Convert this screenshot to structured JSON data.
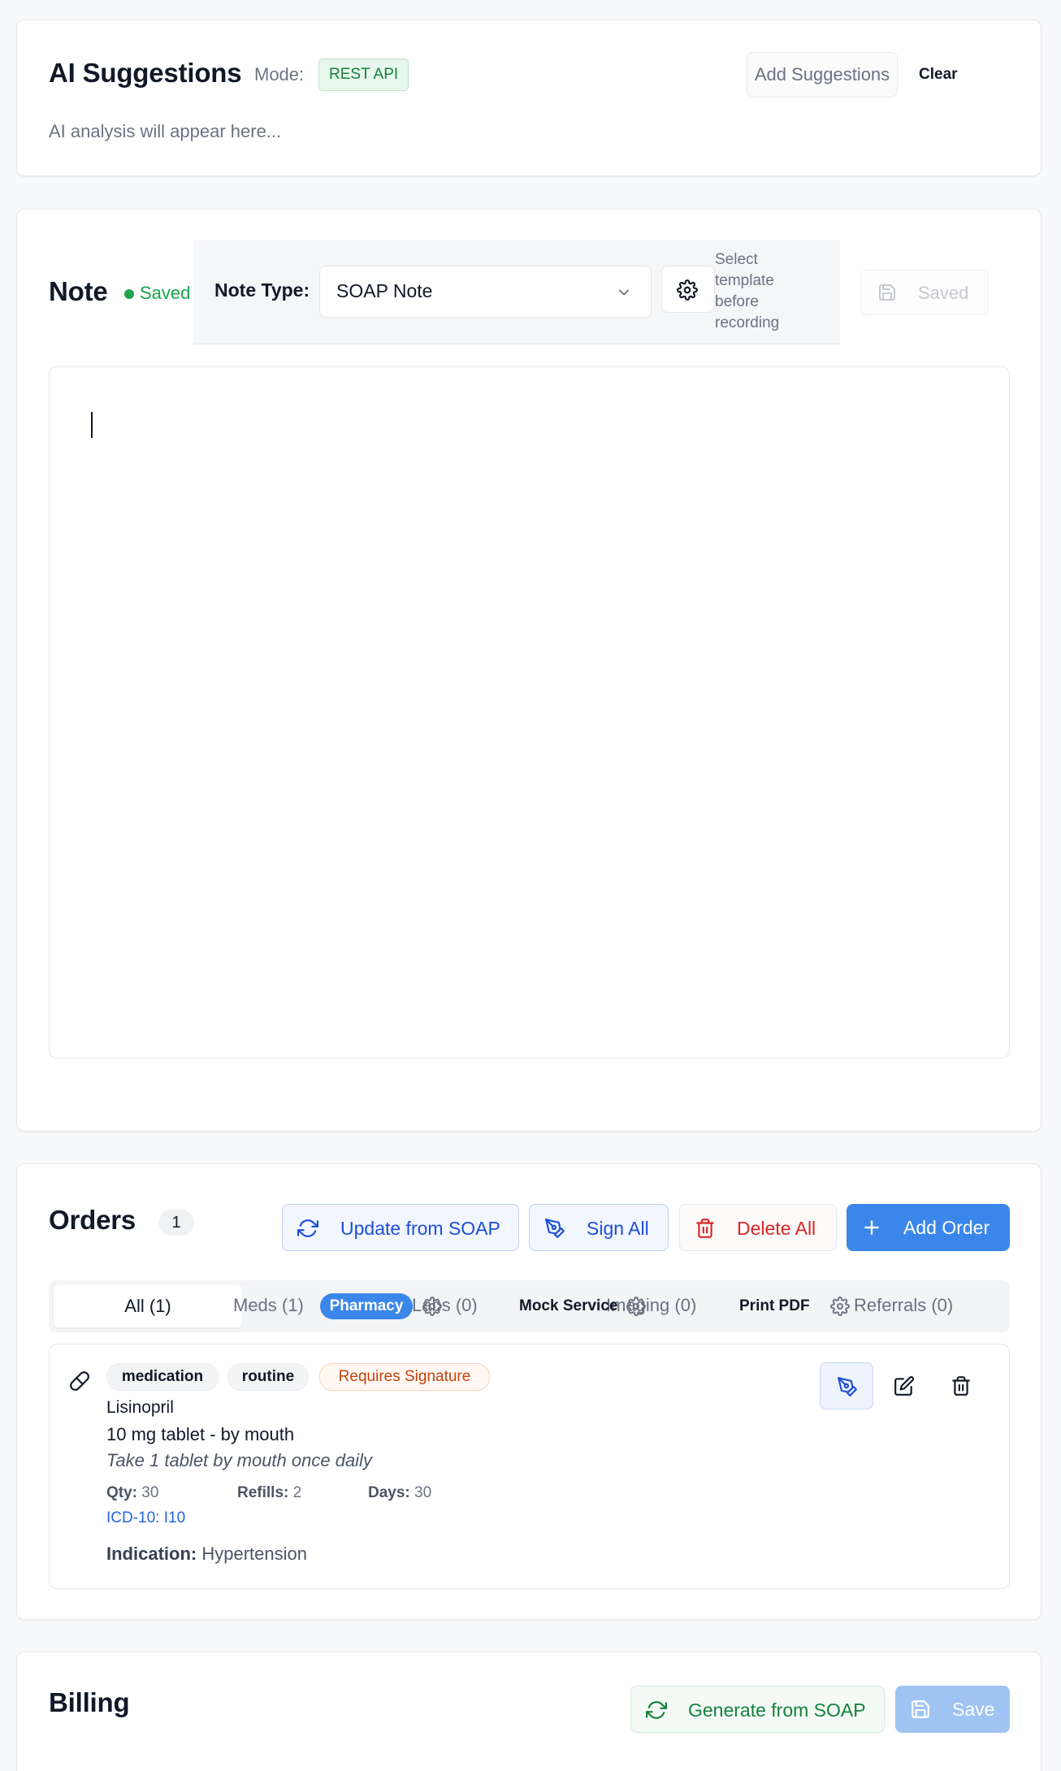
{
  "ai_suggestions": {
    "title": "AI Suggestions",
    "mode_label": "Mode:",
    "mode_value": "REST API",
    "add_label": "Add Suggestions",
    "clear_label": "Clear",
    "placeholder": "AI analysis will appear here..."
  },
  "note": {
    "title": "Note",
    "status": "Saved",
    "note_type_label": "Note Type:",
    "note_type_value": "SOAP Note",
    "hint": "Select template before recording",
    "save_label": "Saved"
  },
  "orders": {
    "title": "Orders",
    "count": "1",
    "update_label": "Update from SOAP",
    "sign_all_label": "Sign All",
    "delete_all_label": "Delete All",
    "add_label": "Add Order",
    "tabs": [
      {
        "label": "All (1)"
      },
      {
        "label": "Meds (1)"
      },
      {
        "label": "Labs (0)"
      },
      {
        "label": "Imaging (0)"
      },
      {
        "label": "Referrals (0)"
      }
    ],
    "overlay": {
      "pharmacy": "Pharmacy",
      "mock_service": "Mock Service",
      "print_pdf": "Print PDF"
    },
    "items": [
      {
        "tags": [
          "medication",
          "routine"
        ],
        "status_tag": "Requires Signature",
        "name": "Lisinopril",
        "dose": "10 mg tablet - by mouth",
        "sig": "Take 1 tablet by mouth once daily",
        "qty_label": "Qty:",
        "qty": "30",
        "refills_label": "Refills:",
        "refills": "2",
        "days_label": "Days:",
        "days": "30",
        "icd": "ICD-10: I10",
        "indication_label": "Indication:",
        "indication": "Hypertension"
      }
    ]
  },
  "billing": {
    "title": "Billing",
    "generate_label": "Generate from SOAP",
    "save_label": "Save"
  },
  "colors": {
    "primary_blue": "#3b86ea",
    "success_green": "#16a34a",
    "danger_red": "#dc2626",
    "warning_orange": "#c2410c"
  },
  "icons": [
    "refresh-icon",
    "pen-icon",
    "trash-icon",
    "plus-icon",
    "gear-icon",
    "chevron-down-icon",
    "save-icon",
    "pill-icon",
    "edit-icon"
  ]
}
